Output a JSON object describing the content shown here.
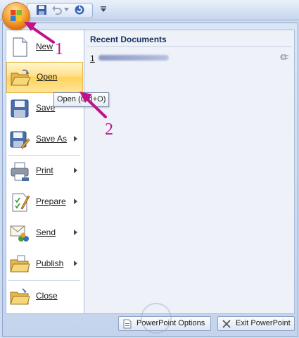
{
  "menu": {
    "items": [
      {
        "label": "New",
        "icon": "new-document-icon",
        "has_submenu": false
      },
      {
        "label": "Open",
        "icon": "open-folder-icon",
        "has_submenu": false
      },
      {
        "label": "Save",
        "icon": "save-disk-icon",
        "has_submenu": false
      },
      {
        "label": "Save As",
        "icon": "save-as-icon",
        "has_submenu": true
      },
      {
        "label": "Print",
        "icon": "printer-icon",
        "has_submenu": true
      },
      {
        "label": "Prepare",
        "icon": "prepare-icon",
        "has_submenu": true
      },
      {
        "label": "Send",
        "icon": "send-icon",
        "has_submenu": true
      },
      {
        "label": "Publish",
        "icon": "publish-folder-icon",
        "has_submenu": true
      },
      {
        "label": "Close",
        "icon": "close-folder-icon",
        "has_submenu": false
      }
    ]
  },
  "recent": {
    "title": "Recent Documents",
    "items": [
      {
        "number": "1"
      }
    ]
  },
  "tooltip": {
    "text": "Open (Ctrl+O)"
  },
  "footer": {
    "options_label": "PowerPoint Options",
    "exit_label": "Exit PowerPoint"
  },
  "annotations": {
    "step1": "1",
    "step2": "2",
    "color": "#c0128c"
  },
  "colors": {
    "hover": "#ffd35c",
    "accent": "#15305e",
    "orb": "#f8a53a"
  }
}
